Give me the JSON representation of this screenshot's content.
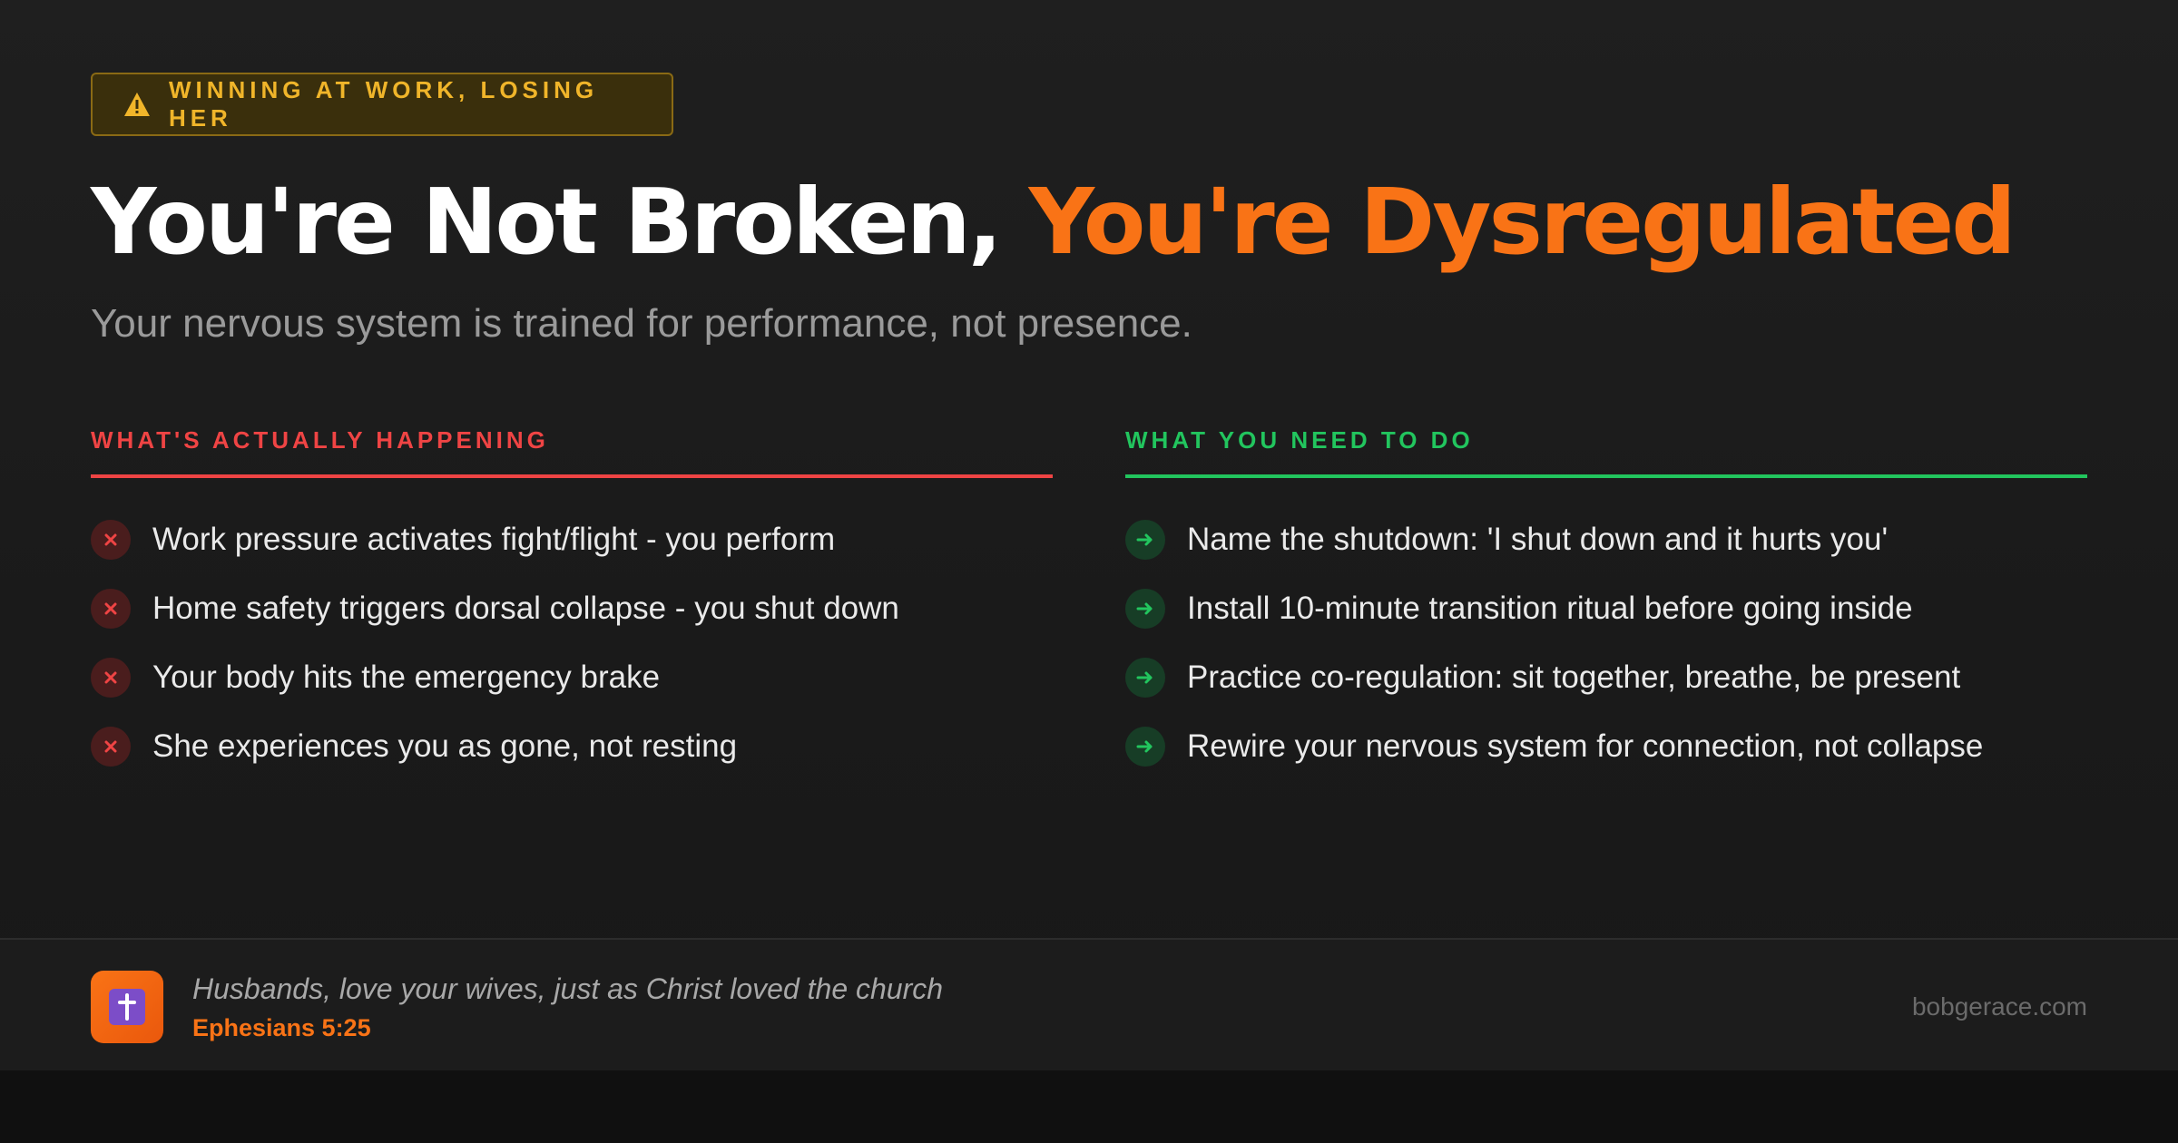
{
  "badge": {
    "label": "WINNING AT WORK, LOSING HER",
    "icon": "warning-icon",
    "color": "#f0b52a"
  },
  "title": {
    "main": "You're Not Broken, ",
    "highlight": "You're Dysregulated",
    "highlight_color": "#f97316"
  },
  "subtitle": "Your nervous system is trained for performance, not presence.",
  "problems": {
    "heading": "WHAT'S ACTUALLY HAPPENING",
    "accent": "#ef4444",
    "icon": "x-icon",
    "items": [
      "Work pressure activates fight/flight - you perform",
      "Home safety triggers dorsal collapse - you shut down",
      "Your body hits the emergency brake",
      "She experiences you as gone, not resting"
    ]
  },
  "actions": {
    "heading": "WHAT YOU NEED TO DO",
    "accent": "#22c55e",
    "icon": "arrow-right-icon",
    "items": [
      "Name the shutdown: 'I shut down and it hurts you'",
      "Install 10-minute transition ritual before going inside",
      "Practice co-regulation: sit together, breathe, be present",
      "Rewire your nervous system for connection, not collapse"
    ]
  },
  "footer": {
    "icon": "cross-icon",
    "quote": "Husbands, love your wives, just as Christ loved the church",
    "reference": "Ephesians 5:25",
    "site": "bobgerace.com"
  }
}
